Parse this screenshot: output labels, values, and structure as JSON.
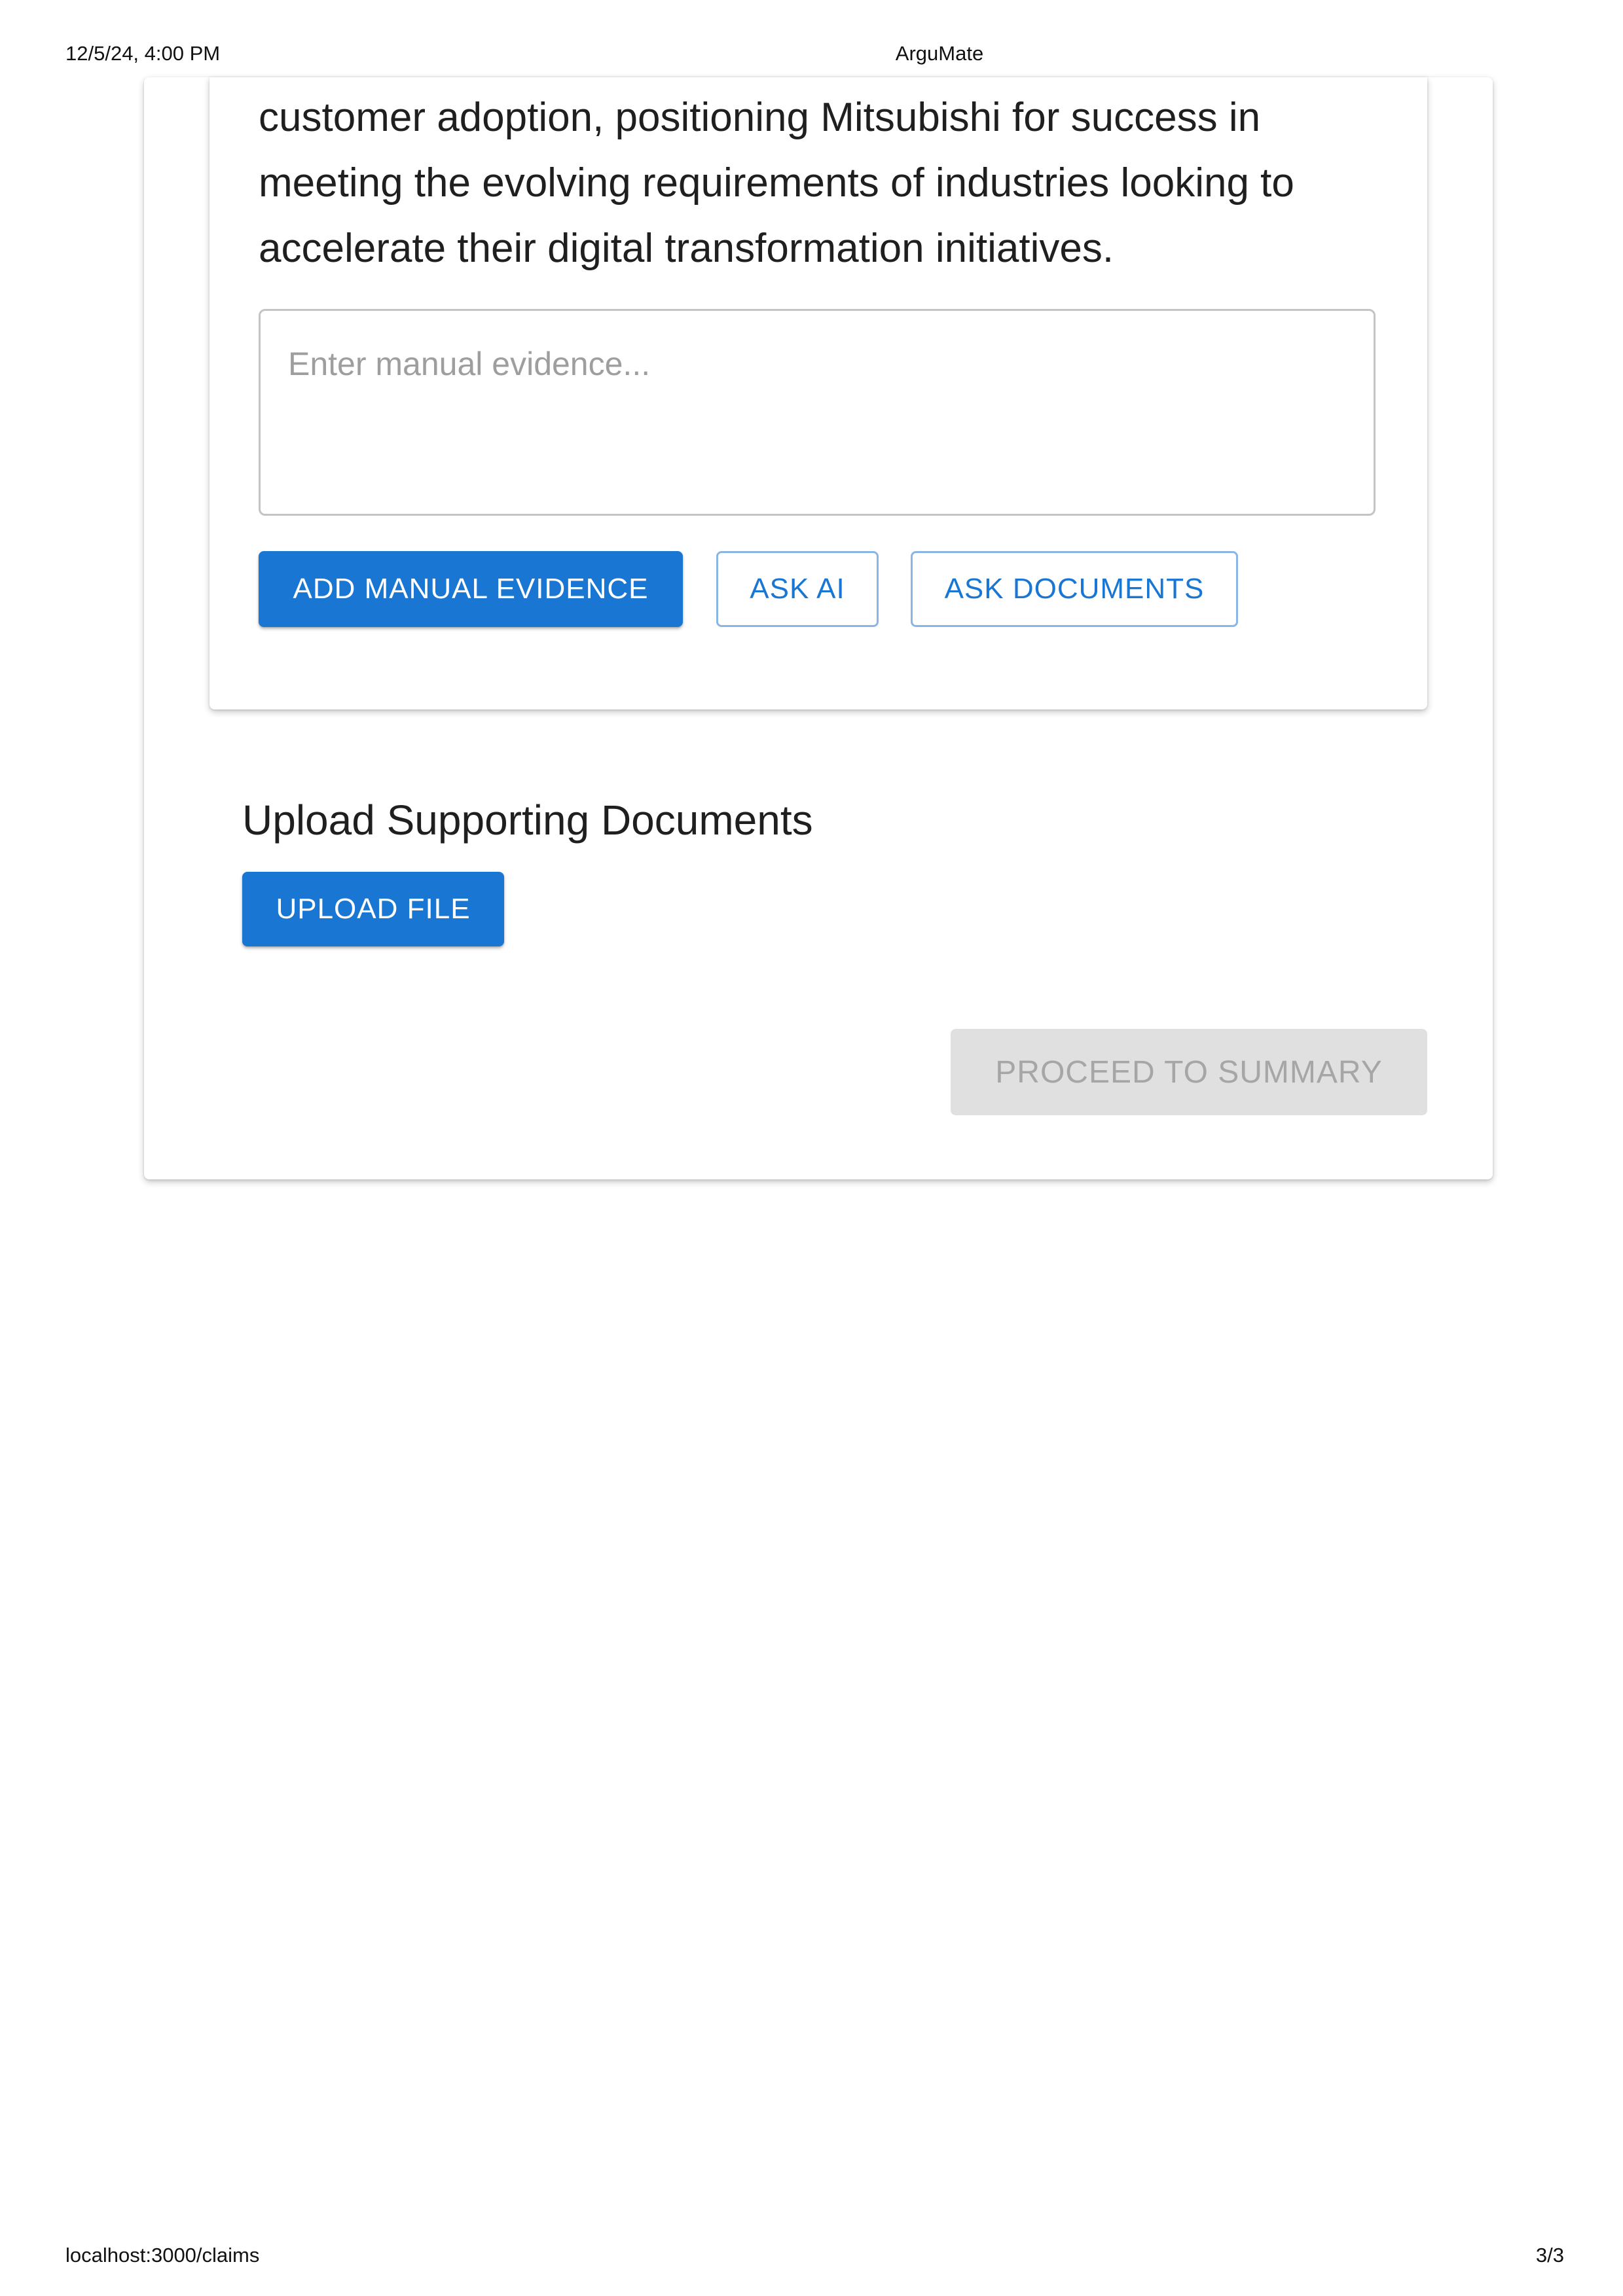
{
  "print_header": {
    "date": "12/5/24, 4:00 PM",
    "title": "ArguMate"
  },
  "print_footer": {
    "url": "localhost:3000/claims",
    "page": "3/3"
  },
  "claim": {
    "text": "customer adoption, positioning Mitsubishi for success in meeting the evolving requirements of industries looking to accelerate their digital transformation initiatives."
  },
  "evidence": {
    "placeholder": "Enter manual evidence...",
    "value": "",
    "add_manual_label": "ADD MANUAL EVIDENCE",
    "ask_ai_label": "ASK AI",
    "ask_documents_label": "ASK DOCUMENTS"
  },
  "upload": {
    "heading": "Upload Supporting Documents",
    "button_label": "UPLOAD FILE"
  },
  "proceed": {
    "label": "PROCEED TO SUMMARY",
    "disabled": true
  },
  "colors": {
    "primary": "#1976d2",
    "outline": "#8ab6e6",
    "disabled_bg": "#e0e0e0",
    "disabled_text": "#a6a6a6",
    "text": "#1f1f1f"
  }
}
